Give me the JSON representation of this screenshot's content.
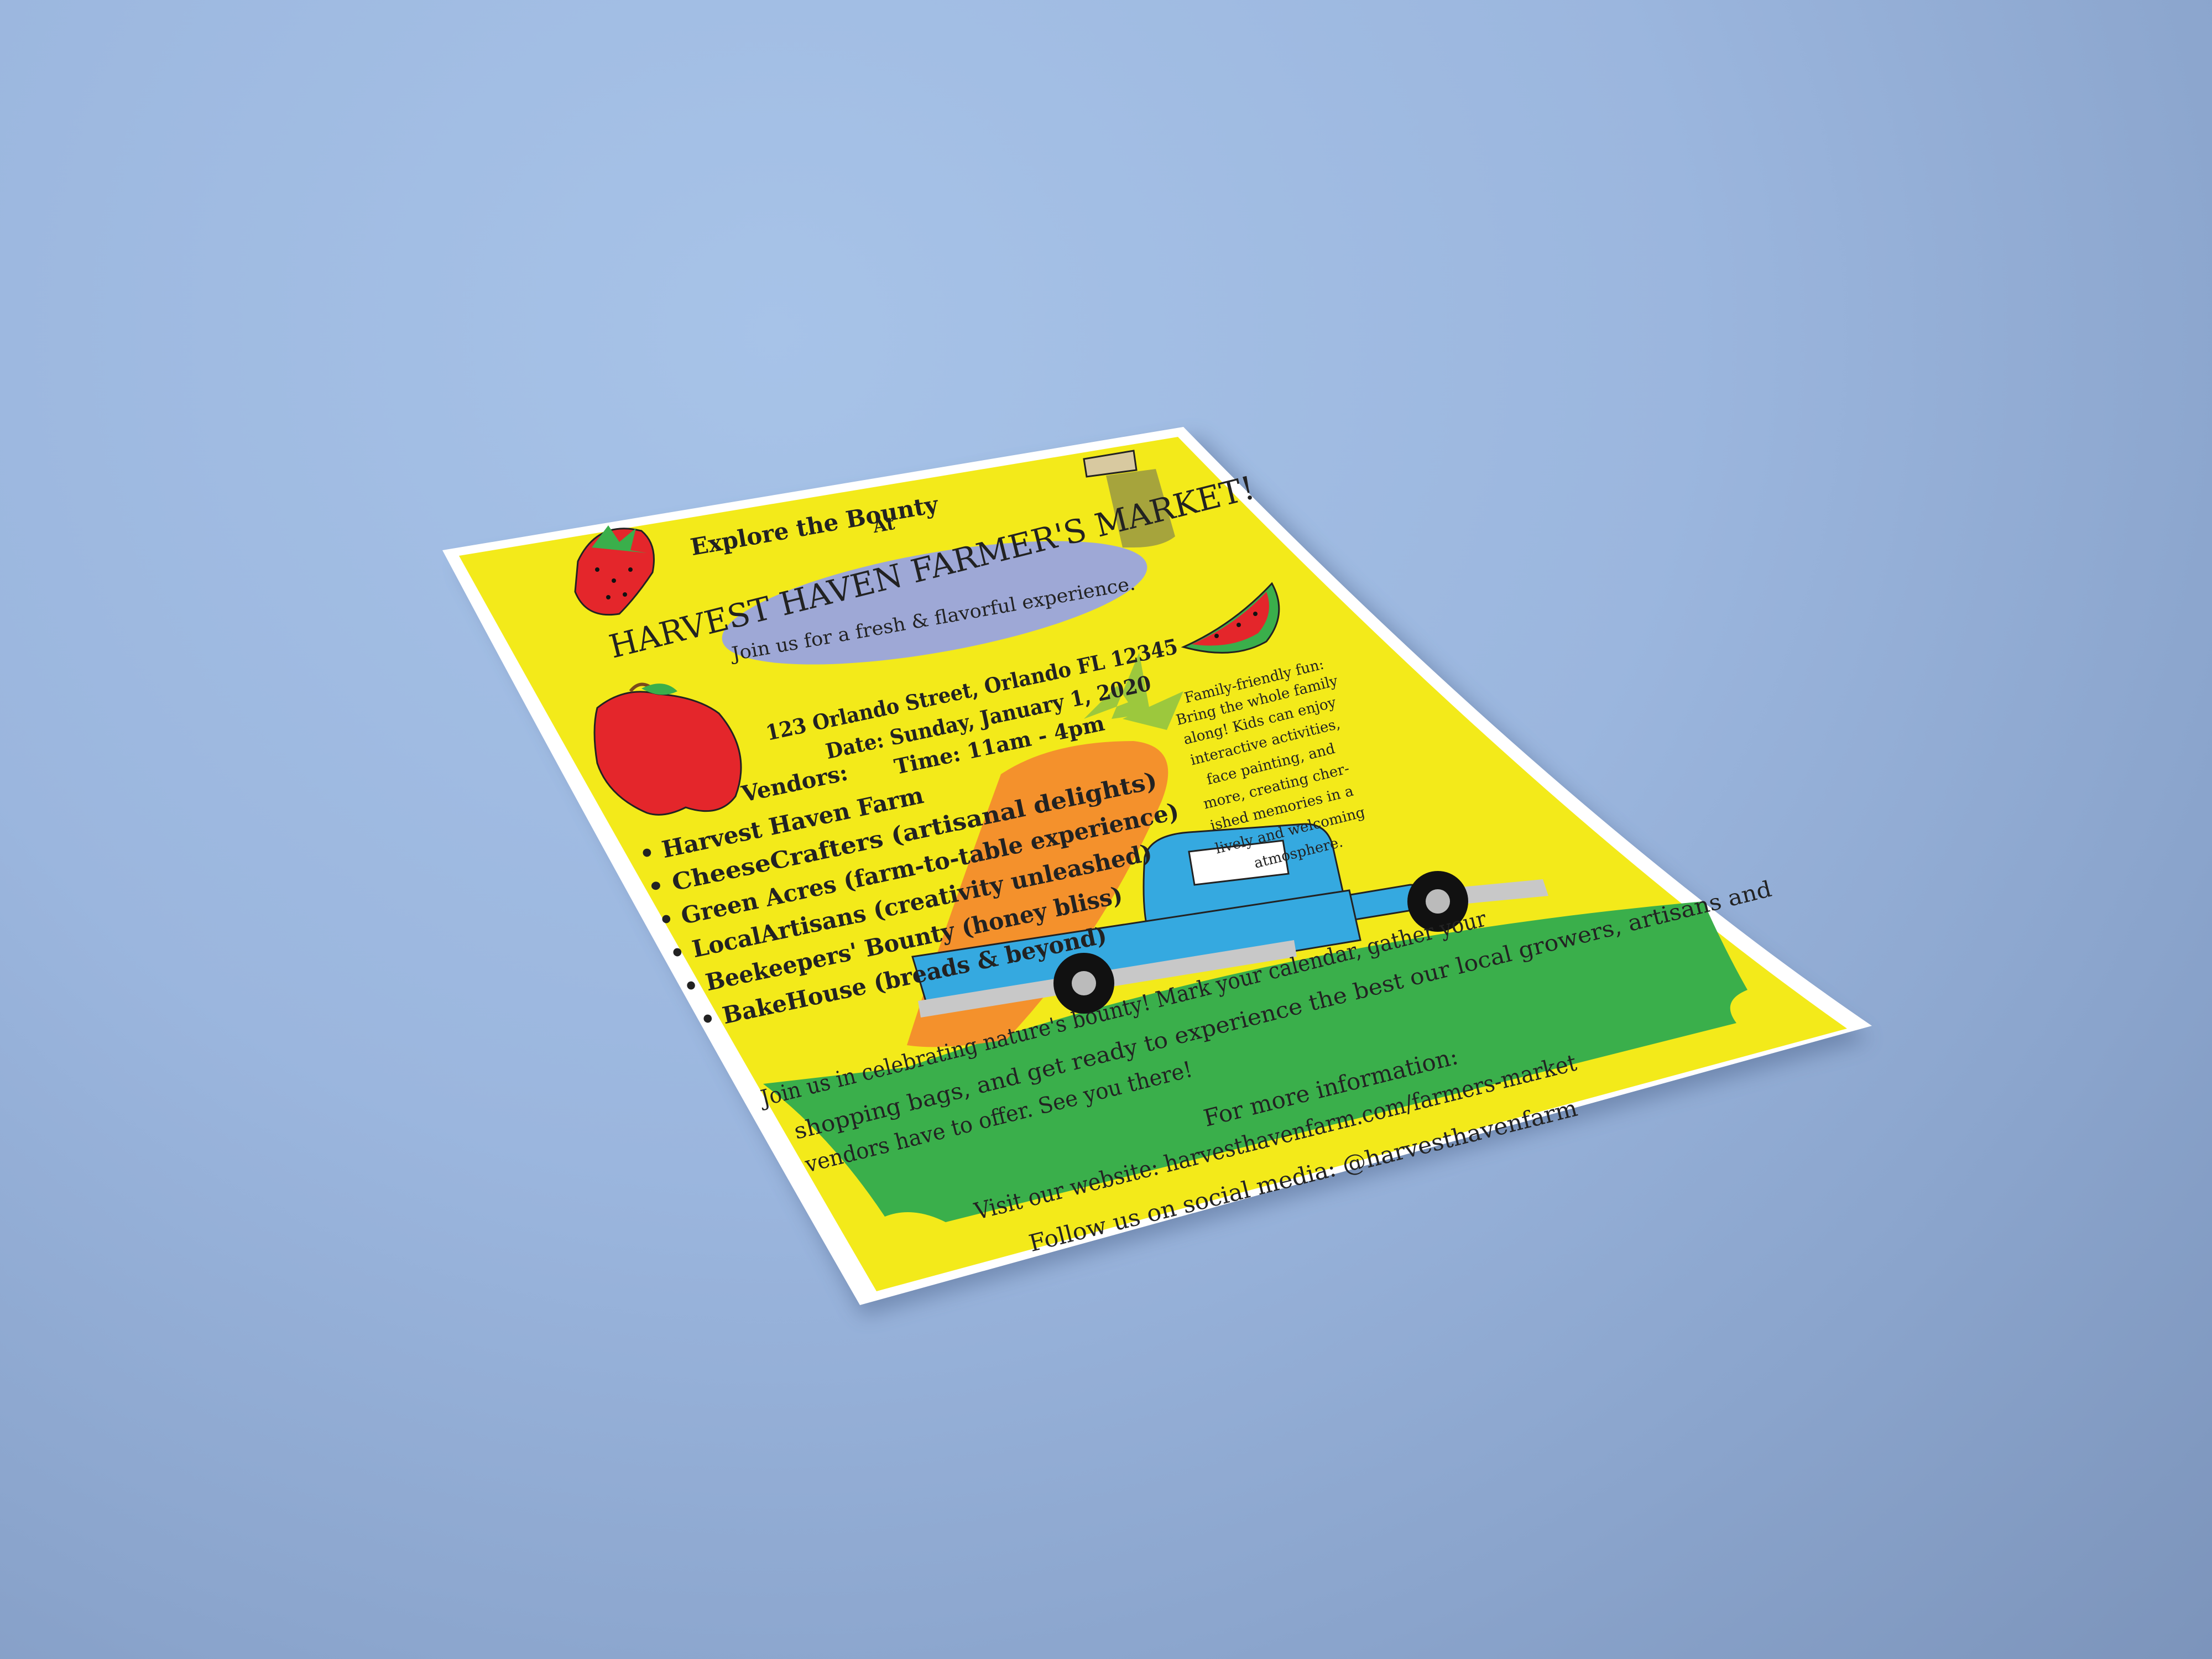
{
  "flyer": {
    "header": {
      "line1": "Explore the Bounty",
      "line2": "At",
      "title": "HARVEST HAVEN FARMER'S MARKET!",
      "tagline": "Join us for a fresh & flavorful experience."
    },
    "details": {
      "address": "123 Orlando Street, Orlando FL 12345",
      "date": "Date: Sunday, January 1, 2020",
      "time": "Time: 11am - 4pm"
    },
    "family_blurb": [
      "Family-friendly fun:",
      "Bring the whole family",
      "along! Kids can enjoy",
      "interactive activities,",
      "face painting, and",
      "more, creating cher-",
      "ished memories in a",
      "lively and welcoming",
      "atmosphere."
    ],
    "vendors": {
      "heading": "Vendors:",
      "items": [
        "Harvest Haven Farm",
        "CheeseCrafters (artisanal delights)",
        "Green Acres (farm-to-table experience)",
        "LocalArtisans (creativity unleashed)",
        "Beekeepers' Bounty (honey bliss)",
        "BakeHouse (breads & beyond)"
      ]
    },
    "closing": [
      "Join us in celebrating nature's bounty! Mark your calendar, gather your",
      "shopping bags, and get ready to experience the best our local growers, artisans and",
      "vendors have to offer. See you there!"
    ],
    "more_info": {
      "heading": "For more information:",
      "website": "Visit our website: harvesthavenfarm.com/farmers-market",
      "social": "Follow us on social media: @harvesthavenfarm"
    },
    "illustrations": [
      "strawberry-icon",
      "jar-icon",
      "watermelon-icon",
      "apple-icon",
      "carrot-icon",
      "truck-icon",
      "grass-banner"
    ]
  },
  "colors": {
    "background": "#9bb6de",
    "paper": "#f3ea1a",
    "oval": "#9ea8d6",
    "grass": "#3aaf4b",
    "truck": "#35a9e0",
    "carrot": "#f4912c",
    "strawberry": "#e4262b",
    "text": "#222222"
  }
}
